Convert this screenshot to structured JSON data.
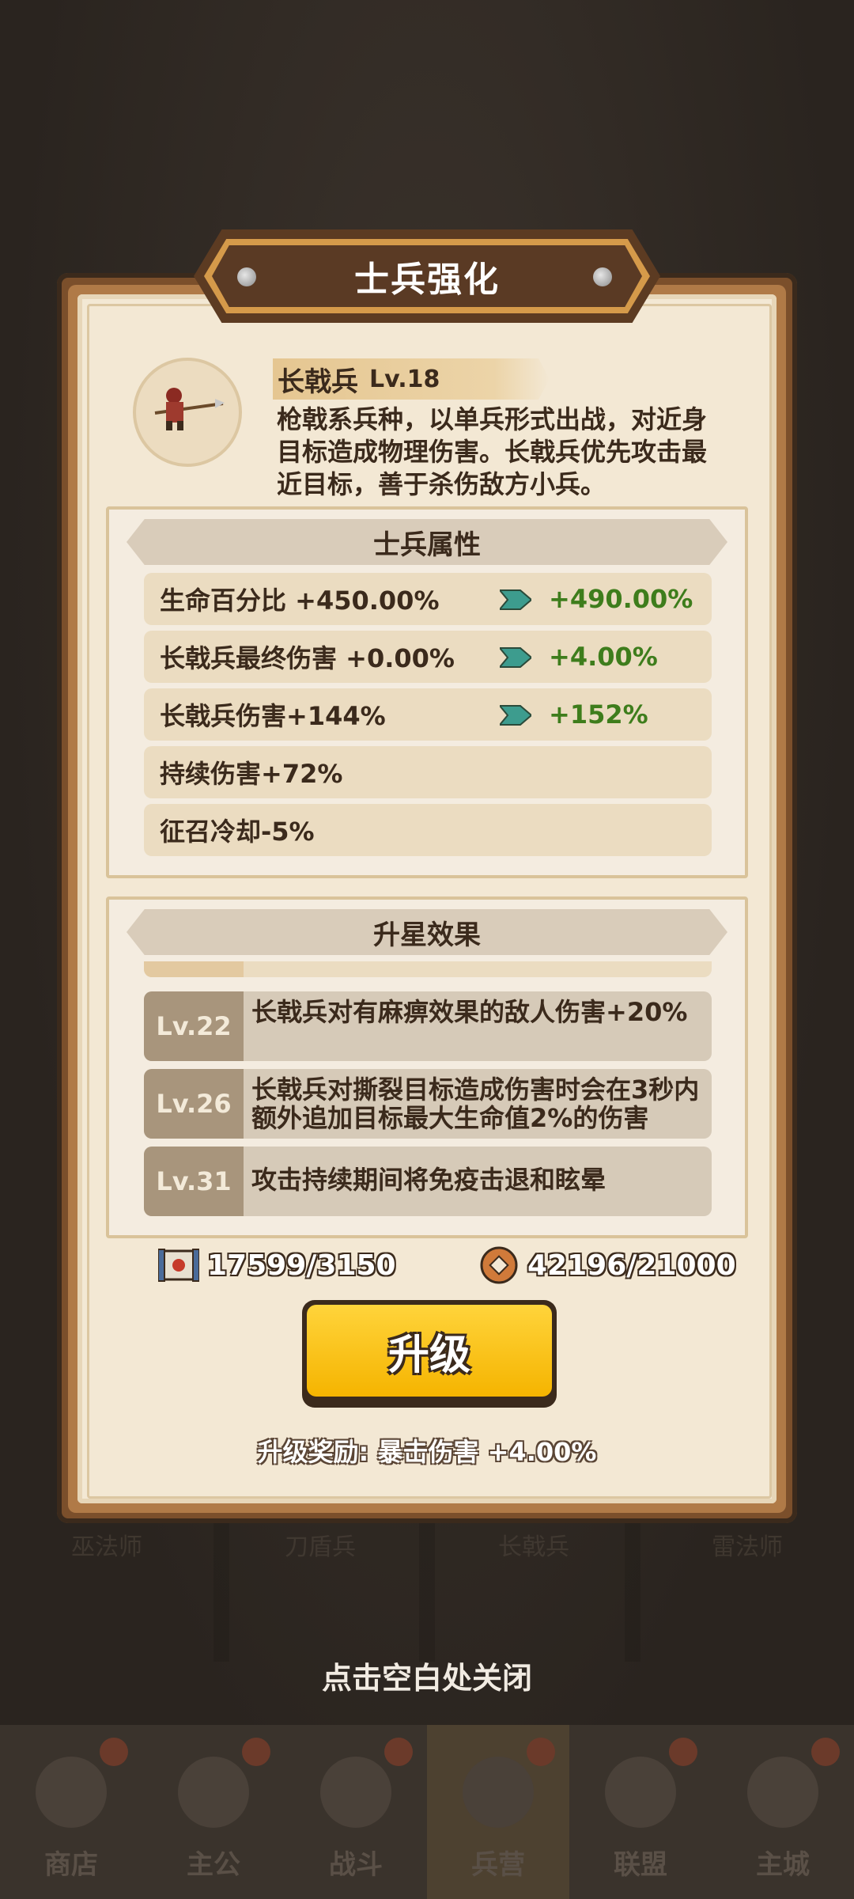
{
  "dialog": {
    "title": "士兵强化",
    "unit_name": "长戟兵",
    "unit_level": "Lv.18",
    "description": "枪戟系兵种，以单兵形式出战，对近身目标造成物理伤害。长戟兵优先攻击最近目标，善于杀伤敌方小兵。"
  },
  "attributes": {
    "header": "士兵属性",
    "rows": [
      {
        "label": "生命百分比 +450.00%",
        "next": "+490.00%"
      },
      {
        "label": "长戟兵最终伤害 +0.00%",
        "next": "+4.00%"
      },
      {
        "label": "长戟兵伤害+144%",
        "next": "+152%"
      },
      {
        "label": "持续伤害+72%"
      },
      {
        "label": "征召冷却-5%"
      }
    ]
  },
  "star_effects": {
    "header": "升星效果",
    "rows": [
      {
        "level": "Lv.22",
        "text": "长戟兵对有麻痹效果的敌人伤害+20%"
      },
      {
        "level": "Lv.26",
        "text": "长戟兵对撕裂目标造成伤害时会在3秒内额外追加目标最大生命值2%的伤害"
      },
      {
        "level": "Lv.31",
        "text": "攻击持续期间将免疫击退和眩晕"
      }
    ]
  },
  "resources": {
    "scroll": "17599/3150",
    "coin": "42196/21000"
  },
  "upgrade": {
    "button_label": "升级",
    "reward_text": "升级奖励: 暴击伤害 +4.00%"
  },
  "close_hint": "点击空白处关闭",
  "bottom_nav": [
    {
      "label": "商店",
      "icon": "shop-icon"
    },
    {
      "label": "主公",
      "icon": "lord-icon"
    },
    {
      "label": "战斗",
      "icon": "battle-icon"
    },
    {
      "label": "兵营",
      "icon": "barracks-icon",
      "active": true
    },
    {
      "label": "联盟",
      "icon": "alliance-icon"
    },
    {
      "label": "主城",
      "icon": "city-icon"
    }
  ],
  "background_tabs": [
    "巫法师",
    "刀盾兵",
    "长戟兵",
    "雷法师"
  ],
  "colors": {
    "accent_green": "#3e7d1c",
    "button_yellow": "#ffd43b",
    "panel_paper": "#f3e8d4"
  }
}
